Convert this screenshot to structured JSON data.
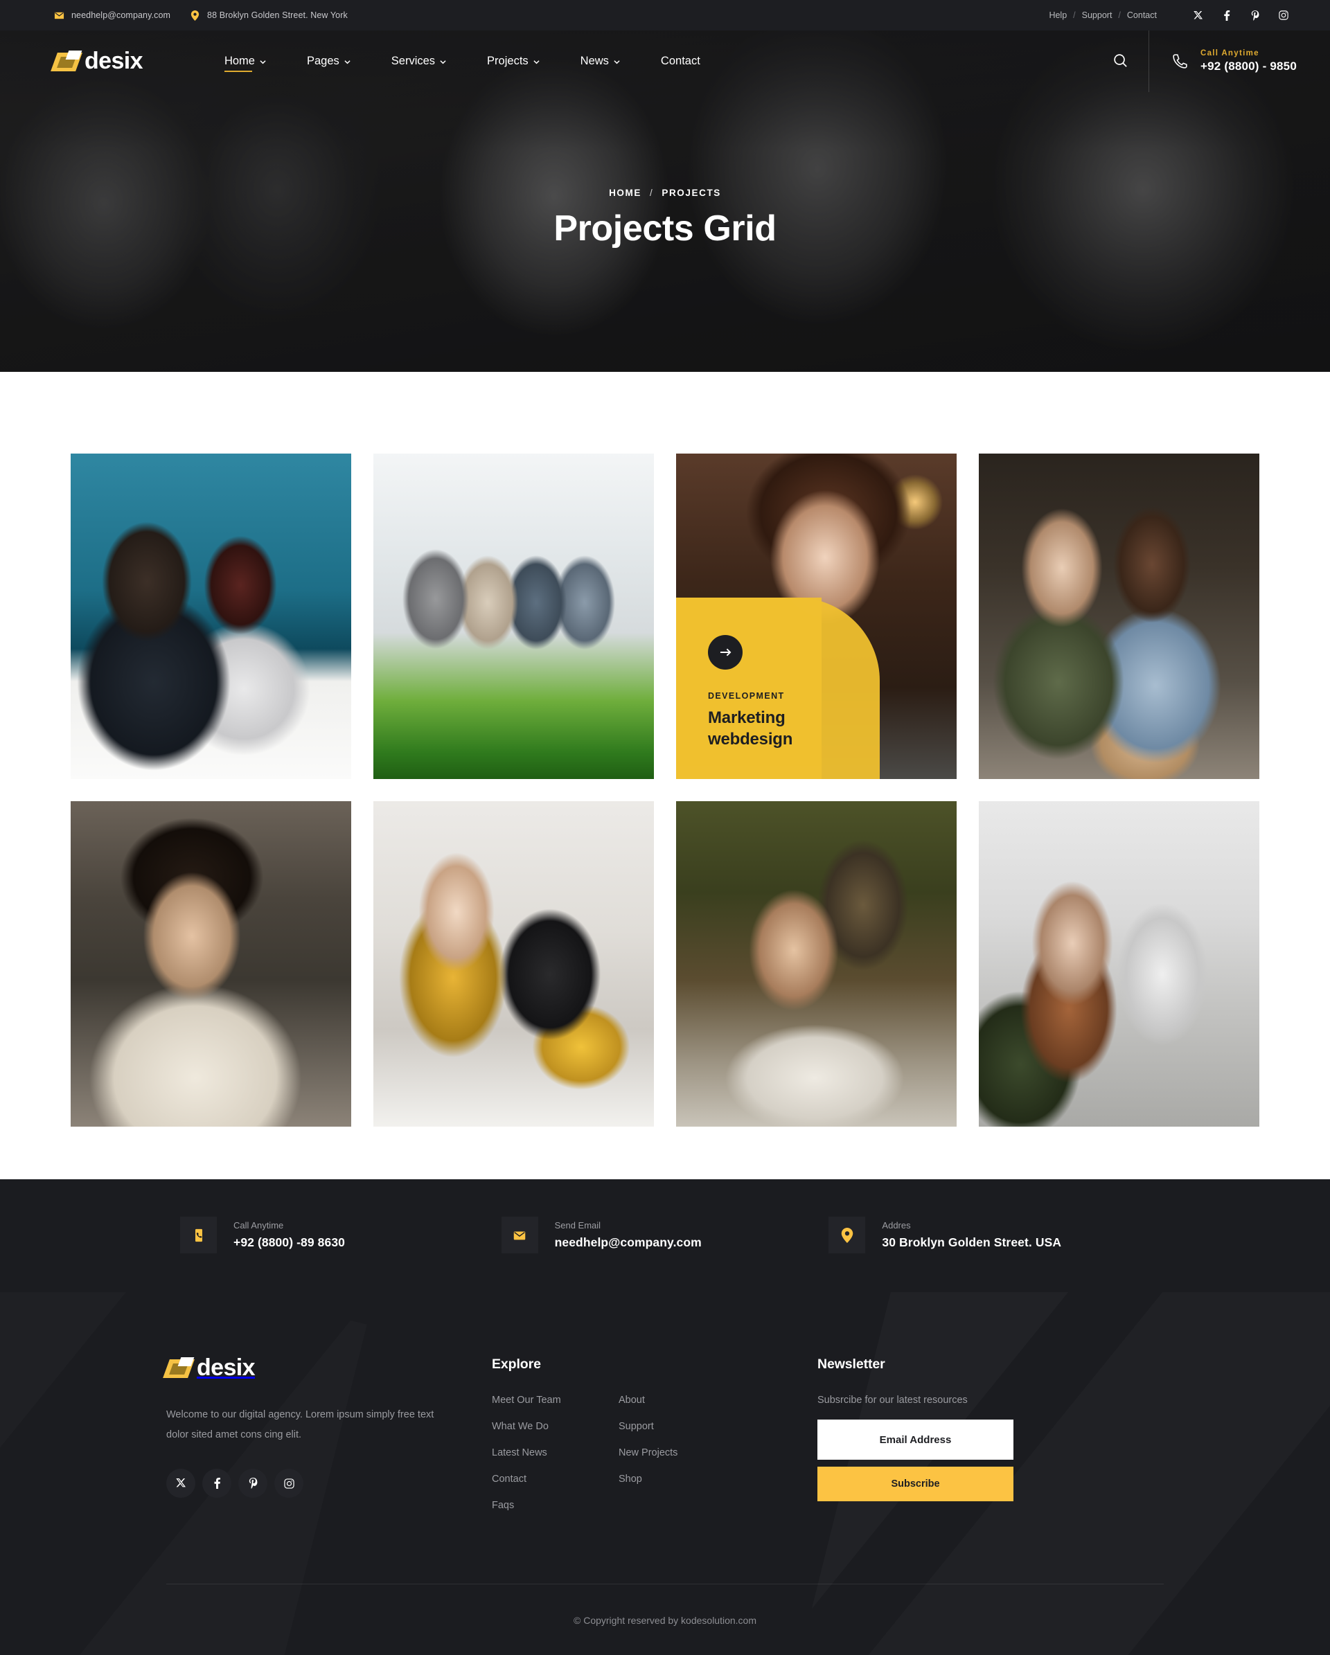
{
  "topbar": {
    "email": "needhelp@company.com",
    "address": "88 Broklyn Golden Street. New York",
    "links": [
      "Help",
      "Support",
      "Contact"
    ],
    "separator": "/",
    "social": [
      "x-icon",
      "facebook-icon",
      "pinterest-icon",
      "instagram-icon"
    ]
  },
  "header": {
    "logo_text": "desix",
    "nav": [
      {
        "label": "Home",
        "has_dropdown": true,
        "active": true
      },
      {
        "label": "Pages",
        "has_dropdown": true,
        "active": false
      },
      {
        "label": "Services",
        "has_dropdown": true,
        "active": false
      },
      {
        "label": "Projects",
        "has_dropdown": true,
        "active": false
      },
      {
        "label": "News",
        "has_dropdown": true,
        "active": false
      },
      {
        "label": "Contact",
        "has_dropdown": false,
        "active": false
      }
    ],
    "search_icon": "search-icon",
    "call_label": "Call Anytime",
    "call_number": "+92 (8800) - 9850"
  },
  "hero": {
    "breadcrumb_home": "HOME",
    "breadcrumb_sep": "/",
    "breadcrumb_current": "PROJECTS",
    "title": "Projects Grid"
  },
  "projects": [
    {
      "id": 1,
      "category": "",
      "title": "",
      "featured": false,
      "image": "img-1"
    },
    {
      "id": 2,
      "category": "",
      "title": "",
      "featured": false,
      "image": "img-2"
    },
    {
      "id": 3,
      "category": "DEVELOPMENT",
      "title": "Marketing\nwebdesign",
      "featured": true,
      "image": "img-3",
      "arrow": "arrow-right-icon"
    },
    {
      "id": 4,
      "category": "",
      "title": "",
      "featured": false,
      "image": "img-4"
    },
    {
      "id": 5,
      "category": "",
      "title": "",
      "featured": false,
      "image": "img-5"
    },
    {
      "id": 6,
      "category": "",
      "title": "",
      "featured": false,
      "image": "img-6"
    },
    {
      "id": 7,
      "category": "",
      "title": "",
      "featured": false,
      "image": "img-7"
    },
    {
      "id": 8,
      "category": "",
      "title": "",
      "featured": false,
      "image": "img-8"
    }
  ],
  "contact_strip": [
    {
      "icon": "phone-icon",
      "label": "Call Anytime",
      "value": "+92 (8800) -89 8630"
    },
    {
      "icon": "envelope-icon",
      "label": "Send Email",
      "value": "needhelp@company.com"
    },
    {
      "icon": "location-pin-icon",
      "label": "Addres",
      "value": "30 Broklyn Golden Street. USA"
    }
  ],
  "footer": {
    "logo_text": "desix",
    "description": "Welcome to our digital agency. Lorem ipsum simply free text dolor sited amet cons cing elit.",
    "social": [
      "x-icon",
      "facebook-icon",
      "pinterest-icon",
      "instagram-icon"
    ],
    "explore_heading": "Explore",
    "explore_col1": [
      "Meet Our Team",
      "What We Do",
      "Latest News",
      "Contact",
      "Faqs"
    ],
    "explore_col2": [
      "About",
      "Support",
      "New Projects",
      "Shop"
    ],
    "newsletter_heading": "Newsletter",
    "newsletter_sub": "Subsrcibe for our latest resources",
    "email_placeholder": "Email Address",
    "email_value": "",
    "subscribe_label": "Subscribe",
    "copyright": "© Copyright reserved by kodesolution.com"
  },
  "colors": {
    "accent": "#fcc343",
    "accent_deep": "#f0c02f",
    "dark": "#1b1c20",
    "dark_alt": "#1d1e22",
    "muted": "#9b9ca1"
  }
}
